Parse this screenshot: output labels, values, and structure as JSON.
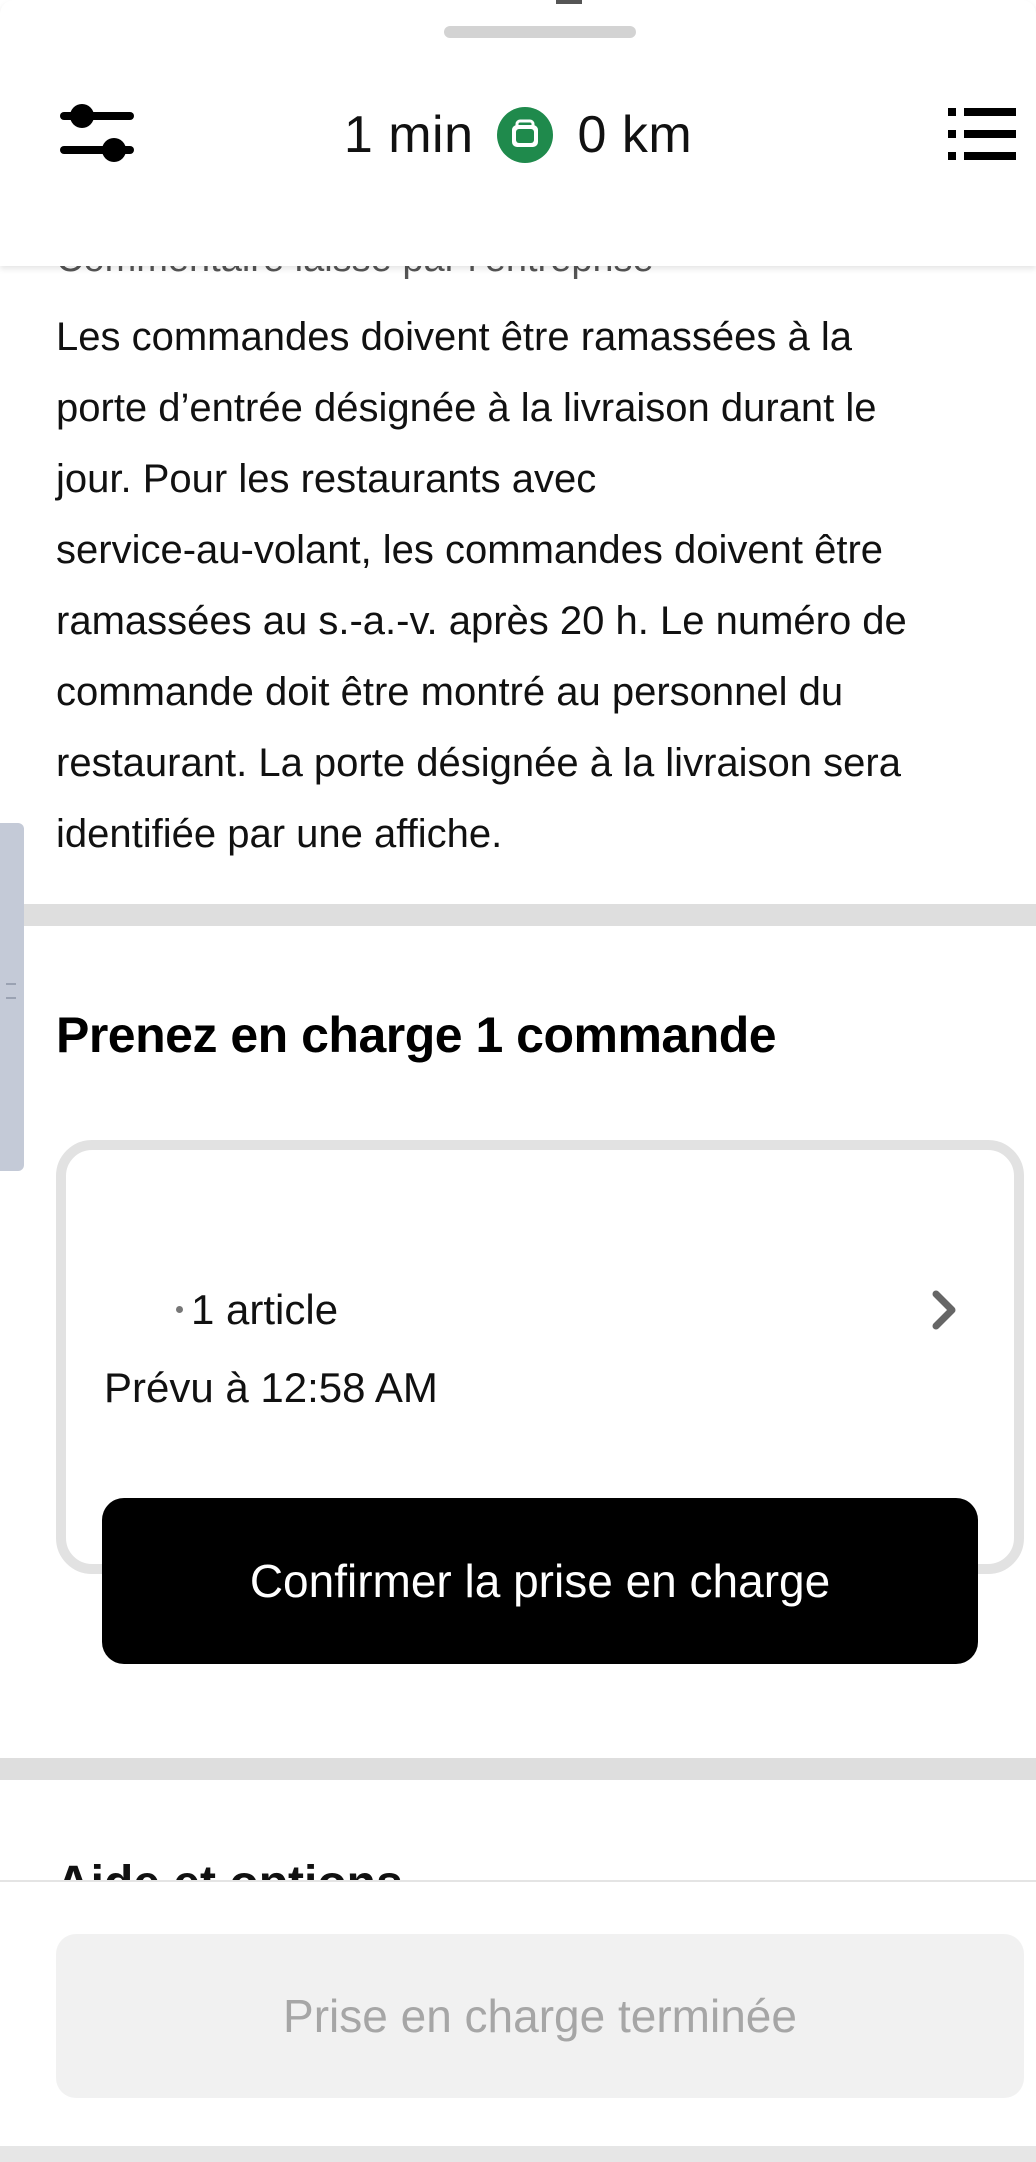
{
  "header": {
    "filter_icon": "sliders-icon",
    "eta": "1 min",
    "bag_icon": "bag-icon",
    "distance": "0 km",
    "list_icon": "list-icon",
    "accent_color": "#1f8a4c"
  },
  "comment": {
    "label": "Commentaire laissé par l’entreprise",
    "lines": [
      "Les commandes doivent être ramassées à la",
      "porte d’entrée désignée à la livraison durant le",
      "jour. Pour les restaurants avec",
      "service-au-volant, les commandes doivent être",
      "ramassées au s.-a.-v. après 20 h. Le numéro de",
      "commande doit être montré au personnel du",
      "restaurant. La porte désignée à la livraison sera",
      "identifiée par une affiche."
    ]
  },
  "pickup": {
    "title": "Prenez en charge 1 commande",
    "order": {
      "summary": "1 article",
      "scheduled": "Prévu à 12:58 AM",
      "chevron_icon": "chevron-right-icon"
    },
    "confirm_label": "Confirmer la prise en charge"
  },
  "next_section_peek": "Aide et options",
  "footer": {
    "done_label": "Prise en charge terminée"
  }
}
